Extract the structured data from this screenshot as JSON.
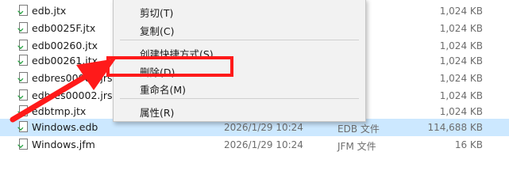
{
  "files": [
    {
      "name": "edb.jtx",
      "date": "",
      "type": "",
      "size": "1,024 KB"
    },
    {
      "name": "edb0025F.jtx",
      "date": "",
      "type": "",
      "size": "1,024 KB"
    },
    {
      "name": "edb00260.jtx",
      "date": "",
      "type": "",
      "size": "1,024 KB"
    },
    {
      "name": "edb00261.jtx",
      "date": "",
      "type": "",
      "size": "1,024 KB"
    },
    {
      "name": "edbres00001.jrs",
      "date": "",
      "type": "",
      "size": "1,024 KB"
    },
    {
      "name": "edbres00002.jrs",
      "date": "",
      "type": "",
      "size": "1,024 KB"
    },
    {
      "name": "edbtmp.jtx",
      "date": "",
      "type": "",
      "size": "1,024 KB"
    },
    {
      "name": "Windows.edb",
      "date": "2026/1/29 10:24",
      "type": "EDB 文件",
      "size": "114,688 KB"
    },
    {
      "name": "Windows.jfm",
      "date": "2026/1/29 10:24",
      "type": "JFM 文件",
      "size": "16 KB"
    }
  ],
  "context_menu": {
    "cut": "剪切(T)",
    "copy": "复制(C)",
    "create_shortcut": "创建快捷方式(S)",
    "delete": "删除(D)",
    "rename": "重命名(M)",
    "properties": "属性(R)"
  },
  "annotation_colors": {
    "highlight": "#ff1a1a",
    "arrow": "#ff1a1a",
    "selection": "#cce8ff"
  }
}
